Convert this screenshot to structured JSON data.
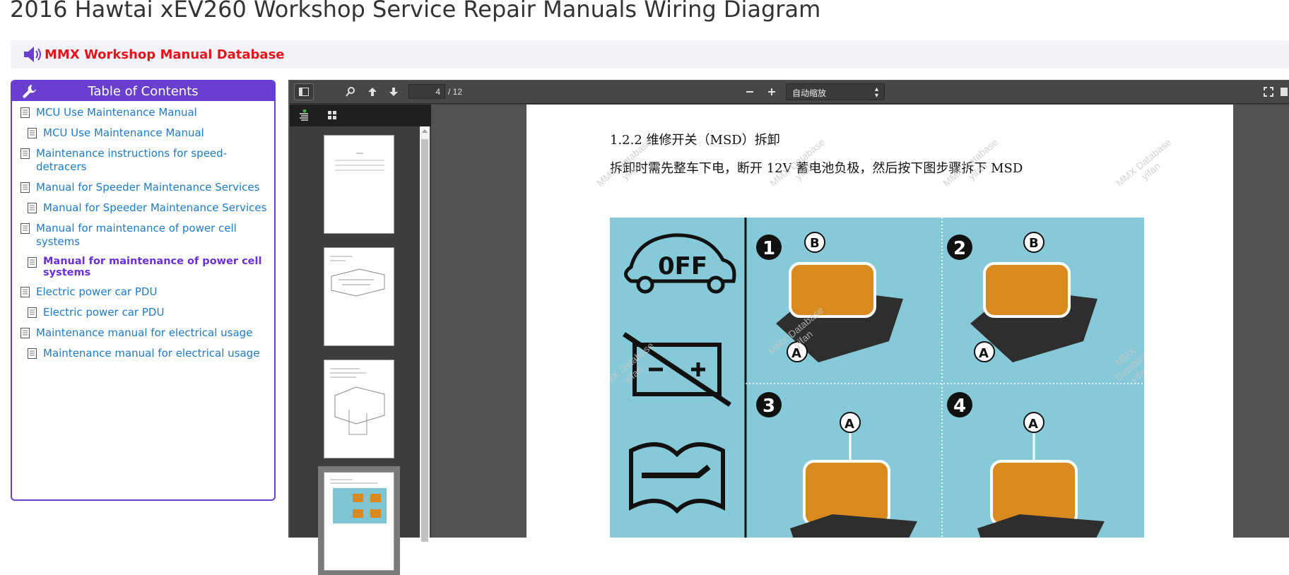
{
  "page": {
    "title": "2016 Hawtai xEV260 Workshop Service Repair Manuals Wiring Diagram"
  },
  "brand": {
    "name": "MMX Workshop Manual Database",
    "color": "#e8121c"
  },
  "toc": {
    "header": "Table of Contents",
    "accent": "#6a3fd0",
    "items": [
      {
        "label": "MCU Use Maintenance Manual",
        "level": 1
      },
      {
        "label": "MCU Use Maintenance Manual",
        "level": 2
      },
      {
        "label": "Maintenance instructions for speed-detracers",
        "level": 1
      },
      {
        "label": "Manual for Speeder Maintenance Services",
        "level": 1
      },
      {
        "label": "Manual for Speeder Maintenance Services",
        "level": 2
      },
      {
        "label": "Manual for maintenance of power cell systems",
        "level": 1
      },
      {
        "label": "Manual for maintenance of power cell systems",
        "level": 2,
        "active": true
      },
      {
        "label": "Electric power car PDU",
        "level": 1
      },
      {
        "label": "Electric power car PDU",
        "level": 2
      },
      {
        "label": "Maintenance manual for electrical usage",
        "level": 1
      },
      {
        "label": "Maintenance manual for electrical usage",
        "level": 2
      }
    ]
  },
  "viewer": {
    "current_page": "4",
    "page_count": "/ 12",
    "zoom_label": "自动缩放",
    "icons": [
      "sidebar-toggle-icon",
      "search-icon",
      "previous-page-icon",
      "next-page-icon",
      "zoom-out-icon",
      "zoom-in-icon",
      "fullscreen-icon",
      "outline-view-icon",
      "thumbnail-view-icon"
    ]
  },
  "document": {
    "heading": "1.2.2 维修开关（MSD）拆卸",
    "body": "拆卸时需先整车下电，断开  12V 蓄电池负极，然后按下图步骤拆下 MSD",
    "watermark_line1": "MMX Database",
    "watermark_line2": "yifan",
    "figure": {
      "off_label": "0FF",
      "steps": [
        "1",
        "2",
        "3",
        "4"
      ],
      "callout_a": "A",
      "callout_b": "B"
    }
  }
}
